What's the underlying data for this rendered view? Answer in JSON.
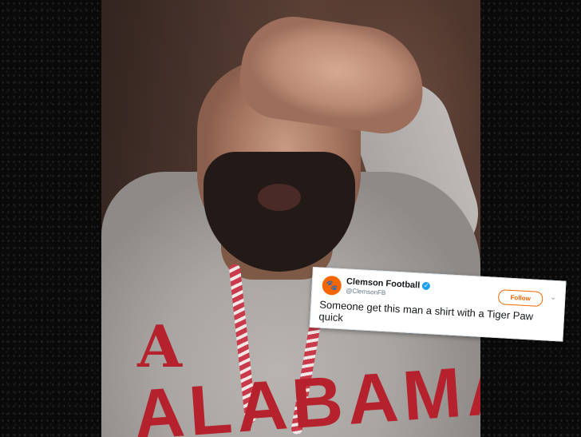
{
  "photo": {
    "logo_letter": "A",
    "shirt_text": "ALABAMA"
  },
  "tweet": {
    "account_name": "Clemson Football",
    "handle": "@ClemsonFB",
    "follow_label": "Follow",
    "text": "Someone get this man a shirt with a Tiger Paw quick",
    "verified_glyph": "✓",
    "chevron_glyph": "⌄",
    "avatar_glyph": "🐾",
    "accent_color": "#f56600"
  }
}
